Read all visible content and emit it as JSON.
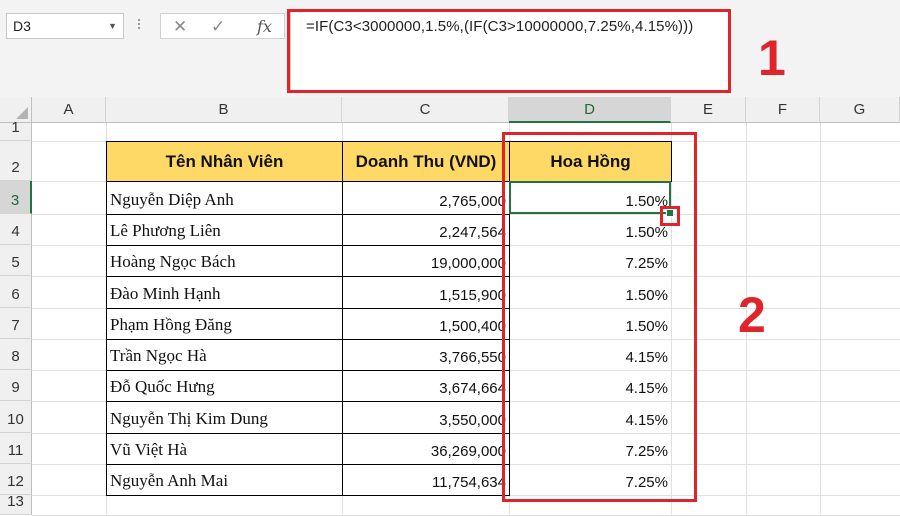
{
  "name_box": {
    "value": "D3"
  },
  "formula_bar": {
    "fx_label": "fx",
    "formula": "=IF(C3<3000000,1.5%,(IF(C3>10000000,7.25%,4.15%)))"
  },
  "annotations": {
    "label_1": "1",
    "label_2": "2"
  },
  "columns": [
    "A",
    "B",
    "C",
    "D",
    "E",
    "F",
    "G"
  ],
  "selected_column": "D",
  "rows": [
    "1",
    "2",
    "3",
    "4",
    "5",
    "6",
    "7",
    "8",
    "9",
    "10",
    "11",
    "12",
    "13"
  ],
  "selected_row": "3",
  "table": {
    "headers": [
      "Tên Nhân Viên",
      "Doanh Thu (VND)",
      "Hoa Hồng"
    ],
    "rows": [
      {
        "name": "Nguyễn Diệp Anh",
        "revenue": "2,765,000",
        "commission": "1.50%"
      },
      {
        "name": "Lê Phương Liên",
        "revenue": "2,247,564",
        "commission": "1.50%"
      },
      {
        "name": "Hoàng Ngọc Bách",
        "revenue": "19,000,000",
        "commission": "7.25%"
      },
      {
        "name": "Đào Minh Hạnh",
        "revenue": "1,515,900",
        "commission": "1.50%"
      },
      {
        "name": "Phạm Hồng Đăng",
        "revenue": "1,500,400",
        "commission": "1.50%"
      },
      {
        "name": "Trần Ngọc Hà",
        "revenue": "3,766,550",
        "commission": "4.15%"
      },
      {
        "name": "Đỗ Quốc Hưng",
        "revenue": "3,674,664",
        "commission": "4.15%"
      },
      {
        "name": "Nguyễn Thị Kim Dung",
        "revenue": "3,550,000",
        "commission": "4.15%"
      },
      {
        "name": "Vũ Việt Hà",
        "revenue": "36,269,000",
        "commission": "7.25%"
      },
      {
        "name": "Nguyễn Anh Mai",
        "revenue": "11,754,634",
        "commission": "7.25%"
      }
    ]
  },
  "colors": {
    "header_fill": "#ffd966",
    "selection": "#217346",
    "annotation": "#e0242b"
  },
  "icons": {
    "cancel": "close-icon",
    "confirm": "check-icon",
    "function": "fx-icon",
    "dropdown": "chevron-down-icon"
  }
}
